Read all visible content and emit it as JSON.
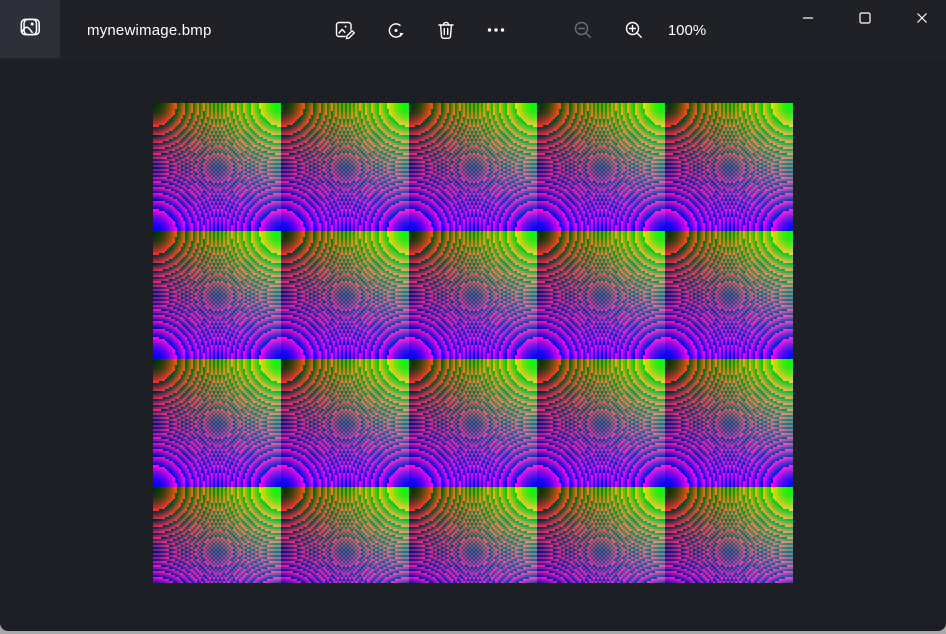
{
  "titlebar": {
    "filename": "mynewimage.bmp",
    "app_icon": "photos-app-icon",
    "toolbar": {
      "edit_icon": "edit-image-icon",
      "rotate_icon": "rotate-icon",
      "delete_icon": "delete-icon",
      "more_icon": "more-options-icon",
      "zoom_out_icon": "zoom-out-icon",
      "zoom_in_icon": "zoom-in-icon",
      "zoom_out_enabled": false,
      "zoom_in_enabled": true
    },
    "zoom_level": "100%"
  },
  "window_controls": {
    "minimize_icon": "minimize-icon",
    "maximize_icon": "maximize-icon",
    "close_icon": "close-icon"
  },
  "colors": {
    "titlebar_bg": "#1f2127",
    "content_bg": "#1c1f25",
    "app_tile_bg": "#2d3038",
    "icon_fg": "#ffffff",
    "icon_disabled_fg": "#6d7076",
    "desktop_strip": "#a9a9a9"
  },
  "viewer": {
    "image": {
      "display_width": 640,
      "display_height": 480,
      "zoom": "100%",
      "pattern": {
        "description": "procedurally generated BMP: concentric interference rings radiating from top-left with moire aliasing, overlaid with vertical green-to-pink-to-blue color bands repeating every 128px, giving a 5x4 tiled psychedelic grid (bottom row cut off at 480px), rendered in 2x2 pixel blocks",
        "logical_width": 320,
        "logical_height": 240,
        "band_period": 64,
        "ring_scale": 2,
        "green_max": 255,
        "green_step": 4,
        "blue_step": 4,
        "x_fade_min": 0.2
      }
    }
  }
}
